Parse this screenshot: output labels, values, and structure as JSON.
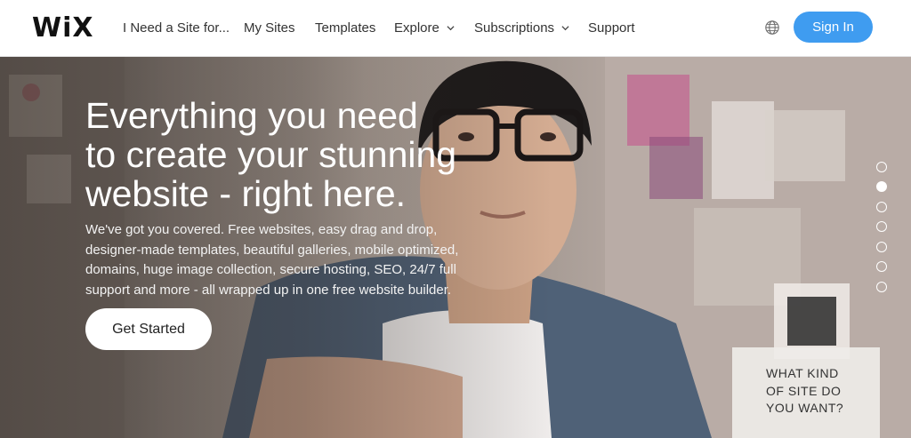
{
  "header": {
    "logo": "WiX",
    "nav": [
      {
        "label": "I Need a Site for...",
        "has_dropdown": false
      },
      {
        "label": "My Sites",
        "has_dropdown": false
      },
      {
        "label": "Templates",
        "has_dropdown": false
      },
      {
        "label": "Explore",
        "has_dropdown": true
      },
      {
        "label": "Subscriptions",
        "has_dropdown": true
      },
      {
        "label": "Support",
        "has_dropdown": false
      }
    ],
    "globe_icon": "globe-icon",
    "sign_in_label": "Sign In"
  },
  "hero": {
    "headline_lines": [
      "Everything you need",
      "to create your stunning",
      "website - right here."
    ],
    "subtext_lines": [
      "We've got you covered. Free websites, easy drag and drop,",
      "designer-made templates, beautiful galleries, mobile optimized,",
      "domains, huge image collection, secure hosting, SEO, 24/7 full",
      "support and more - all wrapped up in one free website builder."
    ],
    "cta_label": "Get Started",
    "slides": {
      "count": 7,
      "active_index": 1
    },
    "site_box_lines": [
      "WHAT KIND",
      "OF SITE DO",
      "YOU WANT?"
    ]
  },
  "colors": {
    "accent": "#3f9cf0",
    "text_dark": "#333333",
    "hero_text": "#ffffff"
  }
}
